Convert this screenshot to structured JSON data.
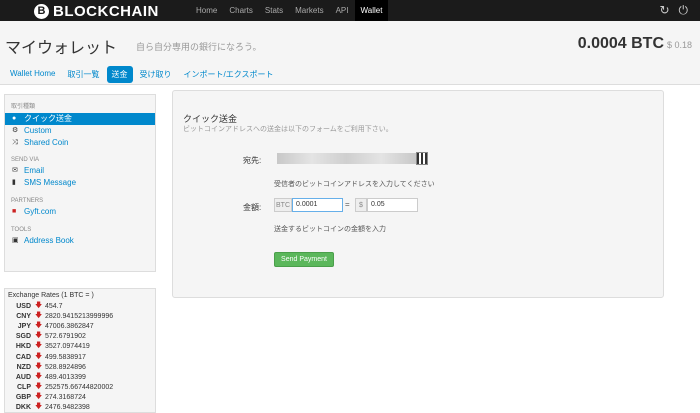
{
  "topbar": {
    "logo_letter": "B",
    "logo": "BLOCKCHAIN",
    "nav": [
      "Home",
      "Charts",
      "Stats",
      "Markets",
      "API",
      "Wallet"
    ],
    "active_nav": "Wallet",
    "icons": [
      "refresh-icon",
      "power-icon"
    ]
  },
  "header": {
    "title": "マイウォレット",
    "subtitle": "自ら自分専用の銀行になろう。",
    "balance": "0.0004 BTC",
    "balance_fiat": "$ 0.18",
    "tabs": [
      "Wallet Home",
      "取引一覧",
      "送金",
      "受け取り",
      "インポート/エクスポート"
    ],
    "active_tab": "送金"
  },
  "sidebar": {
    "section_1": "取引種類",
    "items_1": [
      {
        "label": "クイック送金",
        "icon": "circle-icon"
      },
      {
        "label": "Custom",
        "icon": "gear-icon"
      },
      {
        "label": "Shared Coin",
        "icon": "shuffle-icon"
      }
    ],
    "section_2": "SEND VIA",
    "items_2": [
      {
        "label": "Email",
        "icon": "envelope-icon"
      },
      {
        "label": "SMS Message",
        "icon": "phone-icon"
      }
    ],
    "section_3": "PARTNERS",
    "items_3": [
      {
        "label": "Gyft.com",
        "icon": "gift-icon"
      }
    ],
    "section_4": "TOOLS",
    "items_4": [
      {
        "label": "Address Book",
        "icon": "book-icon"
      }
    ]
  },
  "rates": {
    "title": "Exchange Rates (1 BTC = )",
    "rows": [
      {
        "code": "USD",
        "value": "454.7"
      },
      {
        "code": "CNY",
        "value": "2820.9415213999996"
      },
      {
        "code": "JPY",
        "value": "47006.3862847"
      },
      {
        "code": "SGD",
        "value": "572.6791902"
      },
      {
        "code": "HKD",
        "value": "3527.0974419"
      },
      {
        "code": "CAD",
        "value": "499.5838917"
      },
      {
        "code": "NZD",
        "value": "528.8924896"
      },
      {
        "code": "AUD",
        "value": "489.4013399"
      },
      {
        "code": "CLP",
        "value": "252575.66744820002"
      },
      {
        "code": "GBP",
        "value": "274.3168724"
      },
      {
        "code": "DKK",
        "value": "2476.9482398"
      }
    ]
  },
  "form": {
    "title": "クイック送金",
    "subtitle": "ビットコインアドレスへの送金は以下のフォームをご利用下さい。",
    "to_label": "宛先:",
    "to_help": "受信者のビットコインアドレスを入力してください",
    "amount_label": "金額:",
    "btc_unit": "BTC",
    "btc_value": "0.0001",
    "equals": "=",
    "usd_unit": "$",
    "usd_value": "0.05",
    "amount_help": "送金するビットコインの金額を入力",
    "send_button": "Send Payment"
  }
}
